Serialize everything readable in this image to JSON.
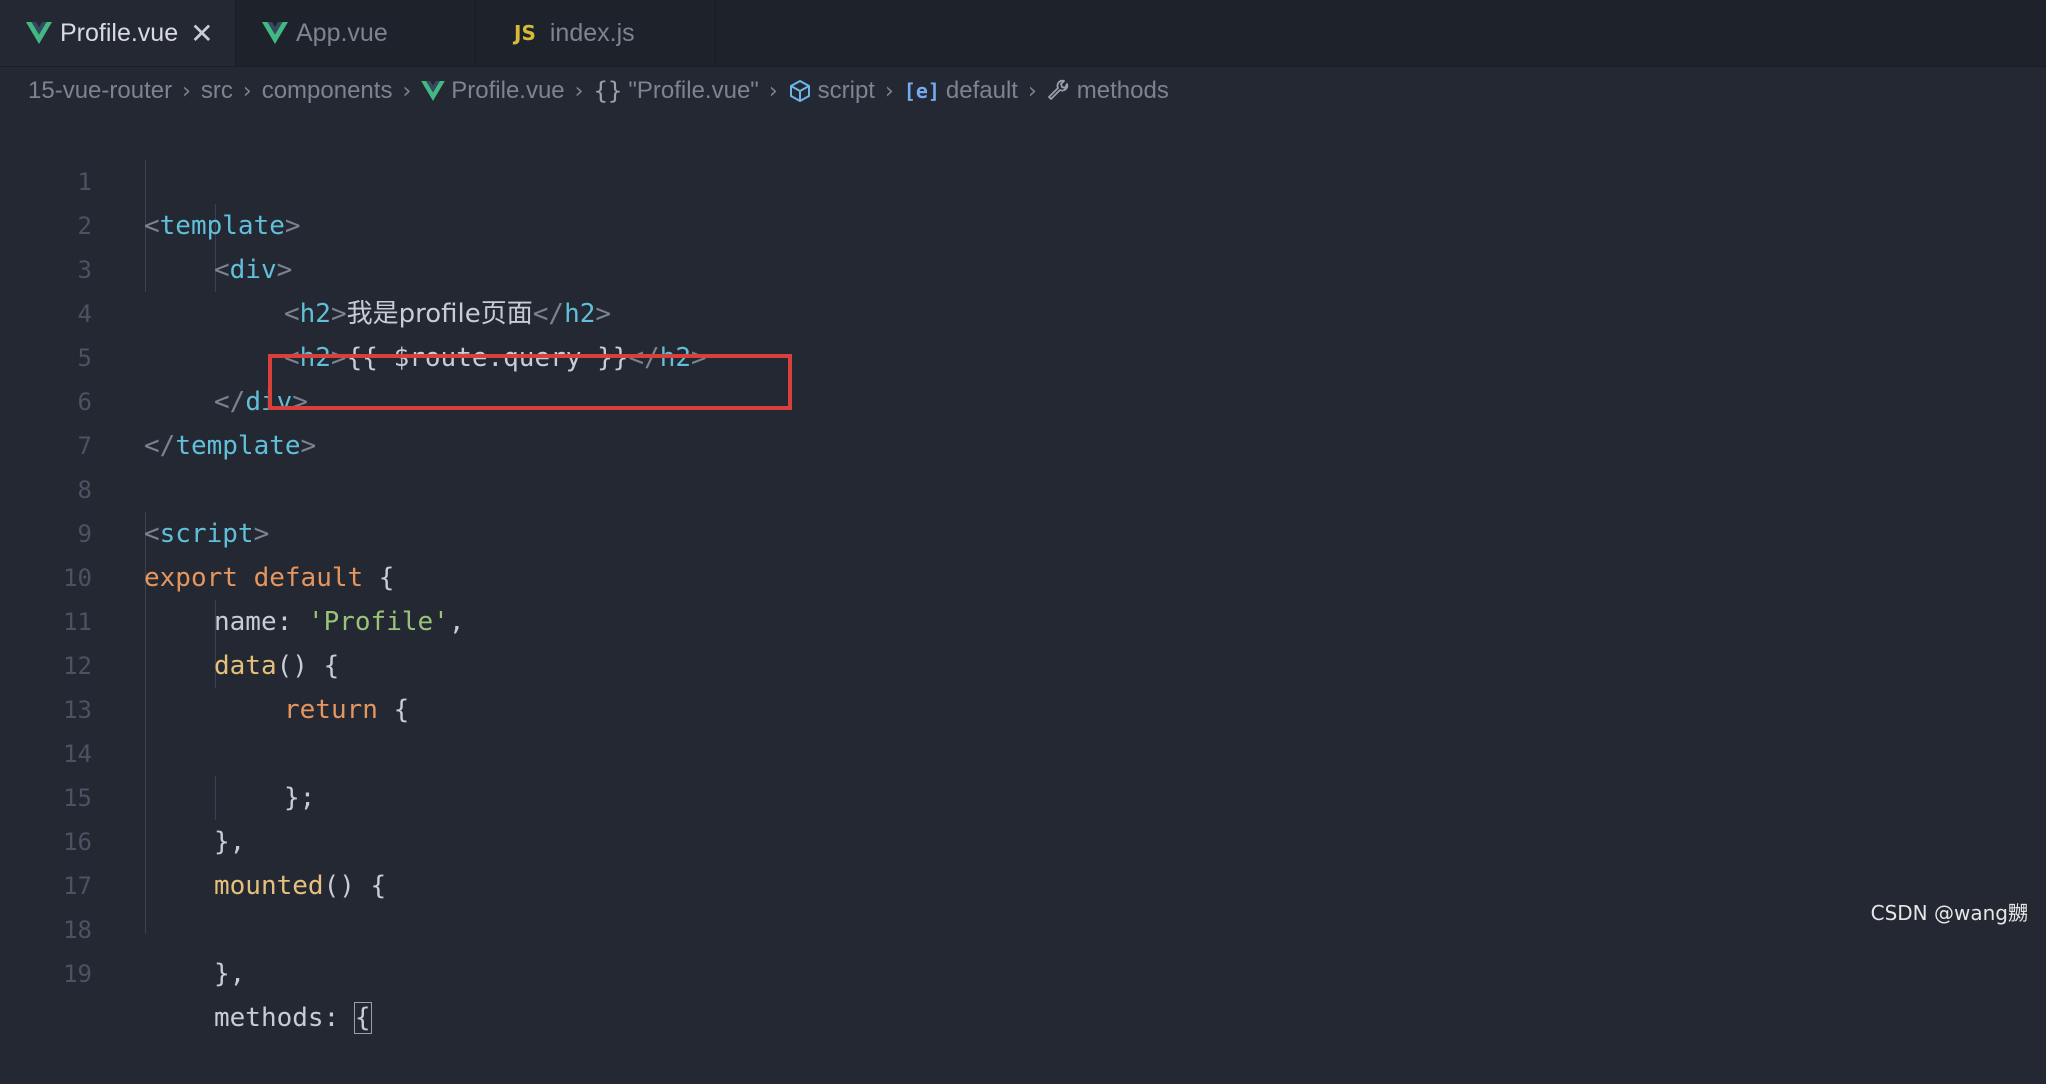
{
  "tabs": [
    {
      "label": "Profile.vue",
      "icon": "vue-icon",
      "active": true,
      "close": "✕"
    },
    {
      "label": "App.vue",
      "icon": "vue-icon",
      "active": false
    },
    {
      "label": "index.js",
      "icon": "js-icon",
      "icon_text": "JS",
      "active": false
    }
  ],
  "breadcrumb": {
    "items": [
      "15-vue-router",
      "src",
      "components",
      "Profile.vue",
      "\"Profile.vue\"",
      "script",
      "default",
      "methods"
    ],
    "braces": "{}",
    "default_icon": "[e]"
  },
  "code_lines": [
    {
      "n": "1"
    },
    {
      "n": "2"
    },
    {
      "n": "3"
    },
    {
      "n": "4"
    },
    {
      "n": "5"
    },
    {
      "n": "6"
    },
    {
      "n": "7"
    },
    {
      "n": "8"
    },
    {
      "n": "9"
    },
    {
      "n": "10"
    },
    {
      "n": "11"
    },
    {
      "n": "12"
    },
    {
      "n": "13"
    },
    {
      "n": "14"
    },
    {
      "n": "15"
    },
    {
      "n": "16"
    },
    {
      "n": "17"
    },
    {
      "n": "18"
    },
    {
      "n": "19"
    }
  ],
  "code": {
    "l1": {
      "open": "<",
      "tag": "template",
      "close": ">"
    },
    "l2": {
      "open": "<",
      "tag": "div",
      "close": ">"
    },
    "l3": {
      "open": "<",
      "tag": "h2",
      "close": ">",
      "text": "我是profile页面",
      "end_open": "</",
      "end_tag": "h2",
      "end_close": ">"
    },
    "l4": {
      "open": "<",
      "tag": "h2",
      "close": ">",
      "text": "{{ $route.query }}",
      "end_open": "</",
      "end_tag": "h2",
      "end_close": ">"
    },
    "l5": {
      "open": "</",
      "tag": "div",
      "close": ">"
    },
    "l6": {
      "open": "</",
      "tag": "template",
      "close": ">"
    },
    "l8": {
      "open": "<",
      "tag": "script",
      "close": ">"
    },
    "l9": {
      "kw1": "export",
      "kw2": "default",
      "rest": " {"
    },
    "l10": {
      "prop": "name",
      "colon": ": ",
      "str": "'Profile'",
      "rest": ","
    },
    "l11": {
      "fn": "data",
      "rest": "() {"
    },
    "l12": {
      "kw": "return",
      "rest": " {"
    },
    "l14": {
      "rest": "};"
    },
    "l15": {
      "rest": "},"
    },
    "l16": {
      "fn": "mounted",
      "rest": "() {"
    },
    "l18": {
      "rest": "},"
    },
    "l19": {
      "prop": "methods",
      "colon": ": ",
      "brace": "{"
    }
  },
  "watermark": "CSDN @wang嬲",
  "colors": {
    "highlight": "#d9403c",
    "tag": "#61bfd9",
    "keyword": "#e5955e",
    "function": "#e5c07b",
    "string": "#98c379"
  }
}
